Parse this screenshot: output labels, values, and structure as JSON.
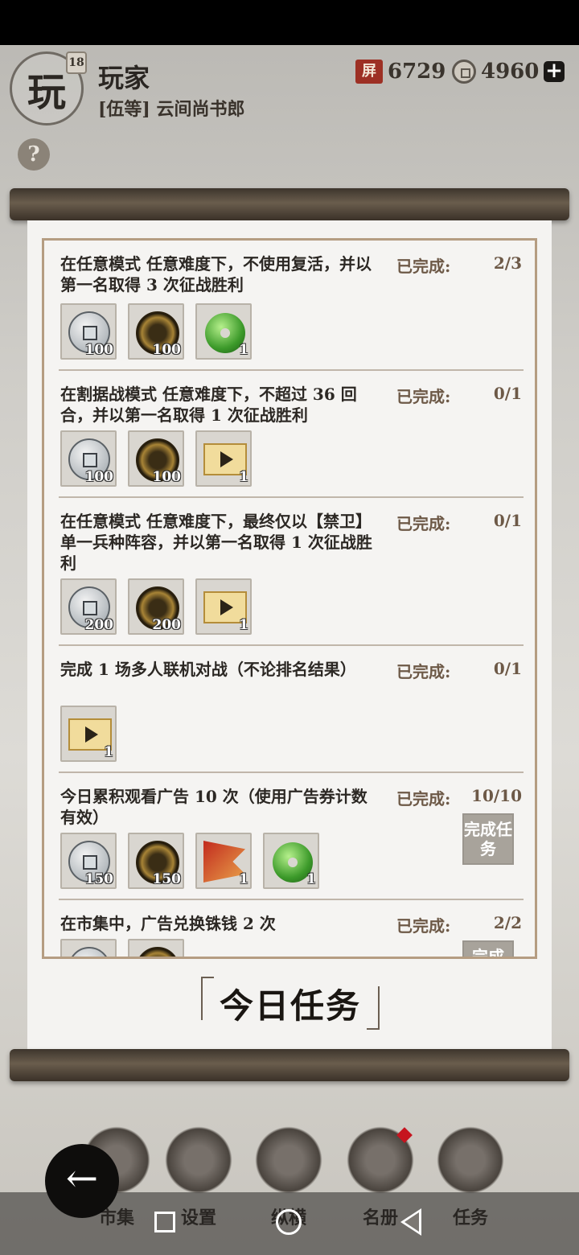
{
  "player": {
    "avatar_char": "玩",
    "level": "18",
    "name": "玩家",
    "title": "[伍等] 云间尚书郎"
  },
  "currency": {
    "c1_icon": "屏",
    "c1_value": "6729",
    "c2_value": "4960",
    "add_label": "+"
  },
  "help_label": "?",
  "status_label": "已完成:",
  "tasks": [
    {
      "desc": "在任意模式 任意难度下，不使用复活，并以第一名取得 3 次征战胜利",
      "progress": "2/3",
      "rewards": [
        {
          "icon": "silver-coin-icon",
          "qty": "100"
        },
        {
          "icon": "gold-coin-icon",
          "qty": "100"
        },
        {
          "icon": "jade-disc-icon",
          "qty": "1"
        }
      ]
    },
    {
      "desc": "在割据战模式 任意难度下，不超过 36 回合，并以第一名取得 1 次征战胜利",
      "progress": "0/1",
      "rewards": [
        {
          "icon": "silver-coin-icon",
          "qty": "100"
        },
        {
          "icon": "gold-coin-icon",
          "qty": "100"
        },
        {
          "icon": "ad-ticket-icon",
          "qty": "1"
        }
      ]
    },
    {
      "desc": "在任意模式 任意难度下，最终仅以【禁卫】单一兵种阵容，并以第一名取得 1 次征战胜利",
      "progress": "0/1",
      "rewards": [
        {
          "icon": "silver-coin-icon",
          "qty": "200"
        },
        {
          "icon": "gold-coin-icon",
          "qty": "200"
        },
        {
          "icon": "ad-ticket-icon",
          "qty": "1"
        }
      ]
    },
    {
      "desc": "完成 1 场多人联机对战（不论排名结果）",
      "progress": "0/1",
      "rewards": [
        {
          "icon": "ad-ticket-icon",
          "qty": "1"
        }
      ]
    },
    {
      "desc": "今日累积观看广告 10 次（使用广告券计数有效）",
      "progress": "10/10",
      "stamp": "完成任务",
      "rewards": [
        {
          "icon": "silver-coin-icon",
          "qty": "150"
        },
        {
          "icon": "gold-coin-icon",
          "qty": "150"
        },
        {
          "icon": "command-flag-icon",
          "qty": "1"
        },
        {
          "icon": "jade-disc-icon",
          "qty": "1"
        }
      ]
    },
    {
      "desc": "在市集中，广告兑换铢钱 2 次",
      "progress": "2/2",
      "stamp": "完成",
      "rewards": [
        {
          "icon": "silver-coin-icon",
          "qty": ""
        },
        {
          "icon": "gold-coin-icon",
          "qty": ""
        }
      ]
    }
  ],
  "daily_title": "今日任务",
  "menu": [
    "市集",
    "设置",
    "纵横",
    "名册",
    "任务"
  ]
}
